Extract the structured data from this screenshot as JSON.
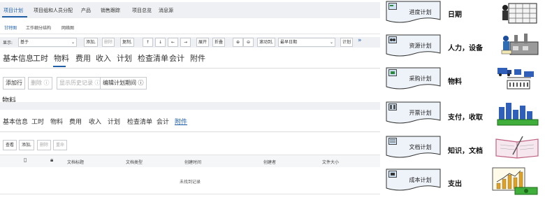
{
  "top_nav": {
    "items": [
      "项目计划",
      "项目组和人员分配",
      "产品",
      "销售跟踪",
      "项目总览",
      "消息源"
    ]
  },
  "sub_nav": {
    "items": [
      "甘特图",
      "工作细分结构",
      "网络图"
    ]
  },
  "toolbar": {
    "display_label": "显示:",
    "display_value": "基于",
    "add_label": "添加,",
    "delete_label": "删除",
    "copy_label": "复制,",
    "expand_label": "展开",
    "collapse_label": "折叠",
    "scroll_to_label": "滚动到,",
    "date_select_value": "最早日期",
    "plan_label": "计划"
  },
  "tabs_primary": {
    "items": [
      "基本信息",
      "工时",
      "物料",
      "费用",
      "收入",
      "计划",
      "检查清单",
      "会计",
      "附件"
    ],
    "active": "物料"
  },
  "material_actions": {
    "add_row": "添加行",
    "delete": "删除",
    "show_history": "显示历史记录",
    "edit_plan_period": "编辑计划期间"
  },
  "material_section_title": "物料",
  "tabs_secondary": {
    "items": [
      "基本信息",
      "工时",
      "物料",
      "费用",
      "收入",
      "计划",
      "检查清单",
      "会计",
      "附件"
    ],
    "active": "附件"
  },
  "attachment_actions": {
    "view": "查看",
    "add": "添加,",
    "delete": "删除",
    "rename": "重命"
  },
  "attachment_table": {
    "columns": [
      "文档标题",
      "文档类型",
      "创建时间",
      "创建者",
      "文件大小"
    ],
    "empty_text": "未找到记录"
  },
  "right_panel": {
    "rows": [
      {
        "card": "进度计划",
        "category": "日期",
        "icon": "calendar-clipart"
      },
      {
        "card": "资源计划",
        "category": "人力，设备",
        "icon": "worker-factory-clipart"
      },
      {
        "card": "采购计划",
        "category": "物料",
        "icon": "supply-chain-clipart"
      },
      {
        "card": "开票计划",
        "category": "支付，收取",
        "icon": "buildings-money-clipart"
      },
      {
        "card": "文档计划",
        "category": "知识，文档",
        "icon": "open-book-clipart"
      },
      {
        "card": "成本计划",
        "category": "支出",
        "icon": "bar-chart-money-clipart"
      }
    ]
  },
  "colors": {
    "accent": "#1f5fa8",
    "toolbar_bg": "#eef0f3",
    "card_bg": "#eef3fa"
  }
}
